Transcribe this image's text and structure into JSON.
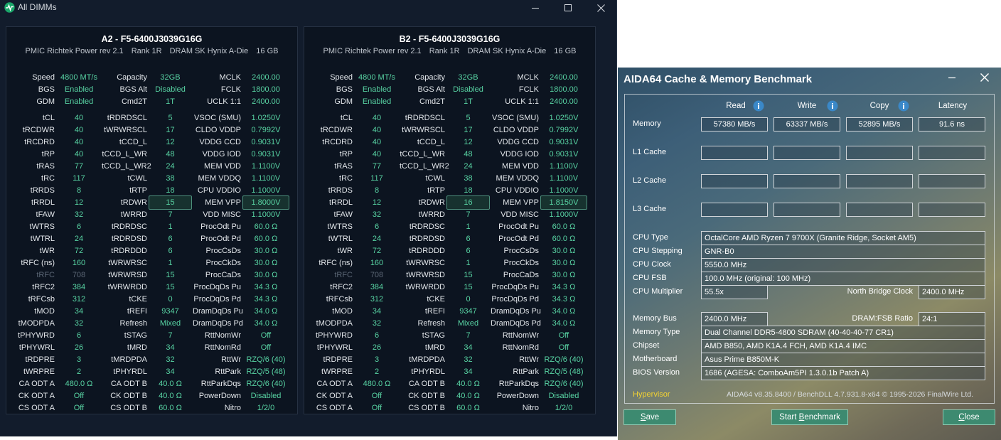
{
  "dimm_window": {
    "title": "All DIMMs",
    "controls": {
      "minimize": "minimize",
      "maximize": "maximize",
      "close": "close"
    },
    "panels": [
      {
        "title": "A2  -  F5-6400J3039G16G",
        "subtitle": [
          "PMIC Richtek Power rev 2.1",
          "Rank 1R",
          "DRAM SK Hynix A-Die",
          "16 GB"
        ],
        "rows": [
          [
            "Speed",
            "4800 MT/s",
            "Capacity",
            "32GB",
            "MCLK",
            "2400.00"
          ],
          [
            "BGS",
            "Enabled",
            "BGS Alt",
            "Disabled",
            "FCLK",
            "1800.00"
          ],
          [
            "GDM",
            "Enabled",
            "Cmd2T",
            "1T",
            "UCLK  1:1",
            "2400.00"
          ],
          [
            "tCL",
            "40",
            "tRDRDSCL",
            "5",
            "VSOC (SMU)",
            "1.0250V"
          ],
          [
            "tRCDWR",
            "40",
            "tWRWRSCL",
            "17",
            "CLDO VDDP",
            "0.7992V"
          ],
          [
            "tRCDRD",
            "40",
            "tCCD_L",
            "12",
            "VDDG CCD",
            "0.9031V"
          ],
          [
            "tRP",
            "40",
            "tCCD_L_WR",
            "48",
            "VDDG IOD",
            "0.9031V"
          ],
          [
            "tRAS",
            "77",
            "tCCD_L_WR2",
            "24",
            "MEM VDD",
            "1.1100V"
          ],
          [
            "tRC",
            "117",
            "tCWL",
            "38",
            "MEM VDDQ",
            "1.1100V"
          ],
          [
            "tRRDS",
            "8",
            "tRTP",
            "18",
            "CPU VDDIO",
            "1.1000V"
          ],
          [
            "tRRDL",
            "12",
            "tRDWR",
            "15",
            "MEM VPP",
            "1.8000V"
          ],
          [
            "tFAW",
            "32",
            "tWRRD",
            "7",
            "VDD MISC",
            "1.1000V"
          ],
          [
            "tWTRS",
            "6",
            "tRDRDSC",
            "1",
            "ProcOdt Pu",
            "60.0 Ω"
          ],
          [
            "tWTRL",
            "24",
            "tRDRDSD",
            "6",
            "ProcOdt Pd",
            "60.0 Ω"
          ],
          [
            "tWR",
            "72",
            "tRDRDDD",
            "6",
            "ProcCsDs",
            "30.0 Ω"
          ],
          [
            "tRFC (ns)",
            "160",
            "tWRWRSC",
            "1",
            "ProcCkDs",
            "30.0 Ω"
          ],
          [
            "tRFC",
            "708",
            "tWRWRSD",
            "15",
            "ProcCaDs",
            "30.0 Ω"
          ],
          [
            "tRFC2",
            "384",
            "tWRWRDD",
            "15",
            "ProcDqDs Pu",
            "34.3 Ω"
          ],
          [
            "tRFCsb",
            "312",
            "tCKE",
            "0",
            "ProcDqDs Pd",
            "34.3 Ω"
          ],
          [
            "tMOD",
            "34",
            "tREFI",
            "9347",
            "DramDqDs Pu",
            "34.0 Ω"
          ],
          [
            "tMODPDA",
            "32",
            "Refresh",
            "Mixed",
            "DramDqDs Pd",
            "34.0 Ω"
          ],
          [
            "tPHYWRD",
            "6",
            "tSTAG",
            "7",
            "RttNomWr",
            "Off"
          ],
          [
            "tPHYWRL",
            "26",
            "tMRD",
            "34",
            "RttNomRd",
            "Off"
          ],
          [
            "tRDPRE",
            "3",
            "tMRDPDA",
            "32",
            "RttWr",
            "RZQ/6 (40)"
          ],
          [
            "tWRPRE",
            "2",
            "tPHYRDL",
            "34",
            "RttPark",
            "RZQ/5 (48)"
          ],
          [
            "CA ODT A",
            "480.0 Ω",
            "CA ODT B",
            "40.0 Ω",
            "RttParkDqs",
            "RZQ/6 (40)"
          ],
          [
            "CK ODT A",
            "Off",
            "CK ODT B",
            "40.0 Ω",
            "PowerDown",
            "Disabled"
          ],
          [
            "CS ODT A",
            "Off",
            "CS ODT B",
            "60.0 Ω",
            "Nitro",
            "1/2/0"
          ]
        ]
      },
      {
        "title": "B2  -  F5-6400J3039G16G",
        "subtitle": [
          "PMIC Richtek Power rev 2.1",
          "Rank 1R",
          "DRAM SK Hynix A-Die",
          "16 GB"
        ],
        "rows": [
          [
            "Speed",
            "4800 MT/s",
            "Capacity",
            "32GB",
            "MCLK",
            "2400.00"
          ],
          [
            "BGS",
            "Enabled",
            "BGS Alt",
            "Disabled",
            "FCLK",
            "1800.00"
          ],
          [
            "GDM",
            "Enabled",
            "Cmd2T",
            "1T",
            "UCLK  1:1",
            "2400.00"
          ],
          [
            "tCL",
            "40",
            "tRDRDSCL",
            "5",
            "VSOC (SMU)",
            "1.0250V"
          ],
          [
            "tRCDWR",
            "40",
            "tWRWRSCL",
            "17",
            "CLDO VDDP",
            "0.7992V"
          ],
          [
            "tRCDRD",
            "40",
            "tCCD_L",
            "12",
            "VDDG CCD",
            "0.9031V"
          ],
          [
            "tRP",
            "40",
            "tCCD_L_WR",
            "48",
            "VDDG IOD",
            "0.9031V"
          ],
          [
            "tRAS",
            "77",
            "tCCD_L_WR2",
            "24",
            "MEM VDD",
            "1.1100V"
          ],
          [
            "tRC",
            "117",
            "tCWL",
            "38",
            "MEM VDDQ",
            "1.1100V"
          ],
          [
            "tRRDS",
            "8",
            "tRTP",
            "18",
            "CPU VDDIO",
            "1.1000V"
          ],
          [
            "tRRDL",
            "12",
            "tRDWR",
            "16",
            "MEM VPP",
            "1.8150V"
          ],
          [
            "tFAW",
            "32",
            "tWRRD",
            "7",
            "VDD MISC",
            "1.1000V"
          ],
          [
            "tWTRS",
            "6",
            "tRDRDSC",
            "1",
            "ProcOdt Pu",
            "60.0 Ω"
          ],
          [
            "tWTRL",
            "24",
            "tRDRDSD",
            "6",
            "ProcOdt Pd",
            "60.0 Ω"
          ],
          [
            "tWR",
            "72",
            "tRDRDDD",
            "6",
            "ProcCsDs",
            "30.0 Ω"
          ],
          [
            "tRFC (ns)",
            "160",
            "tWRWRSC",
            "1",
            "ProcCkDs",
            "30.0 Ω"
          ],
          [
            "tRFC",
            "708",
            "tWRWRSD",
            "15",
            "ProcCaDs",
            "30.0 Ω"
          ],
          [
            "tRFC2",
            "384",
            "tWRWRDD",
            "15",
            "ProcDqDs Pu",
            "34.3 Ω"
          ],
          [
            "tRFCsb",
            "312",
            "tCKE",
            "0",
            "ProcDqDs Pd",
            "34.3 Ω"
          ],
          [
            "tMOD",
            "34",
            "tREFI",
            "9347",
            "DramDqDs Pu",
            "34.0 Ω"
          ],
          [
            "tMODPDA",
            "32",
            "Refresh",
            "Mixed",
            "DramDqDs Pd",
            "34.0 Ω"
          ],
          [
            "tPHYWRD",
            "6",
            "tSTAG",
            "7",
            "RttNomWr",
            "Off"
          ],
          [
            "tPHYWRL",
            "26",
            "tMRD",
            "34",
            "RttNomRd",
            "Off"
          ],
          [
            "tRDPRE",
            "3",
            "tMRDPDA",
            "32",
            "RttWr",
            "RZQ/6 (40)"
          ],
          [
            "tWRPRE",
            "2",
            "tPHYRDL",
            "34",
            "RttPark",
            "RZQ/5 (48)"
          ],
          [
            "CA ODT A",
            "480.0 Ω",
            "CA ODT B",
            "40.0 Ω",
            "RttParkDqs",
            "RZQ/6 (40)"
          ],
          [
            "CK ODT A",
            "Off",
            "CK ODT B",
            "40.0 Ω",
            "PowerDown",
            "Disabled"
          ],
          [
            "CS ODT A",
            "Off",
            "CS ODT B",
            "60.0 Ω",
            "Nitro",
            "1/2/0"
          ]
        ]
      }
    ],
    "highlighted": [
      "tRDWR",
      "MEM VPP"
    ],
    "dimmed": [
      "tRFC"
    ],
    "colors": {
      "value": "#58d3a3",
      "label": "#e2e6ea",
      "dimmed": "#5b6675",
      "background": "#121c2c"
    }
  },
  "aida": {
    "title": "AIDA64 Cache & Memory Benchmark",
    "columns": [
      "Read",
      "Write",
      "Copy",
      "Latency"
    ],
    "rows": [
      {
        "label": "Memory",
        "values": [
          "57380 MB/s",
          "63337 MB/s",
          "52895 MB/s",
          "91.6 ns"
        ]
      },
      {
        "label": "L1 Cache",
        "values": [
          "",
          "",
          "",
          ""
        ]
      },
      {
        "label": "L2 Cache",
        "values": [
          "",
          "",
          "",
          ""
        ]
      },
      {
        "label": "L3 Cache",
        "values": [
          "",
          "",
          "",
          ""
        ]
      }
    ],
    "cpu": {
      "type_label": "CPU Type",
      "type": "OctalCore AMD Ryzen 7 9700X  (Granite Ridge, Socket AM5)",
      "stepping_label": "CPU Stepping",
      "stepping": "GNR-B0",
      "clock_label": "CPU Clock",
      "clock": "5550.0 MHz",
      "fsb_label": "CPU FSB",
      "fsb": "100.0 MHz  (original: 100 MHz)",
      "multiplier_label": "CPU Multiplier",
      "multiplier": "55.5x",
      "nb_clock_label": "North Bridge Clock",
      "nb_clock": "2400.0 MHz"
    },
    "mem": {
      "bus_label": "Memory Bus",
      "bus": "2400.0 MHz",
      "ratio_label": "DRAM:FSB Ratio",
      "ratio": "24:1",
      "type_label": "Memory Type",
      "type": "Dual Channel DDR5-4800 SDRAM  (40-40-40-77 CR1)",
      "chipset_label": "Chipset",
      "chipset": "AMD B850, AMD K1A.4 FCH, AMD K1A.4 IMC",
      "motherboard_label": "Motherboard",
      "motherboard": "Asus Prime B850M-K",
      "bios_label": "BIOS Version",
      "bios": "1686  (AGESA: ComboAm5PI 1.3.0.1b Patch A)"
    },
    "hypervisor": "Hypervisor",
    "footer": "AIDA64 v8.35.8400 / BenchDLL 4.7.931.8-x64  © 1995-2026 FinalWire Ltd.",
    "buttons": {
      "save": "Save",
      "save_hotkey": "S",
      "start_pre": "Start ",
      "start_hotkey": "B",
      "start_post": "enchmark",
      "close_pre": "",
      "close_hotkey": "C",
      "close_post": "lose",
      "save_post": "ave"
    },
    "colors": {
      "button": "#3d8a70",
      "hypervisor": "#f2d233",
      "info": "#3a88c8"
    }
  }
}
